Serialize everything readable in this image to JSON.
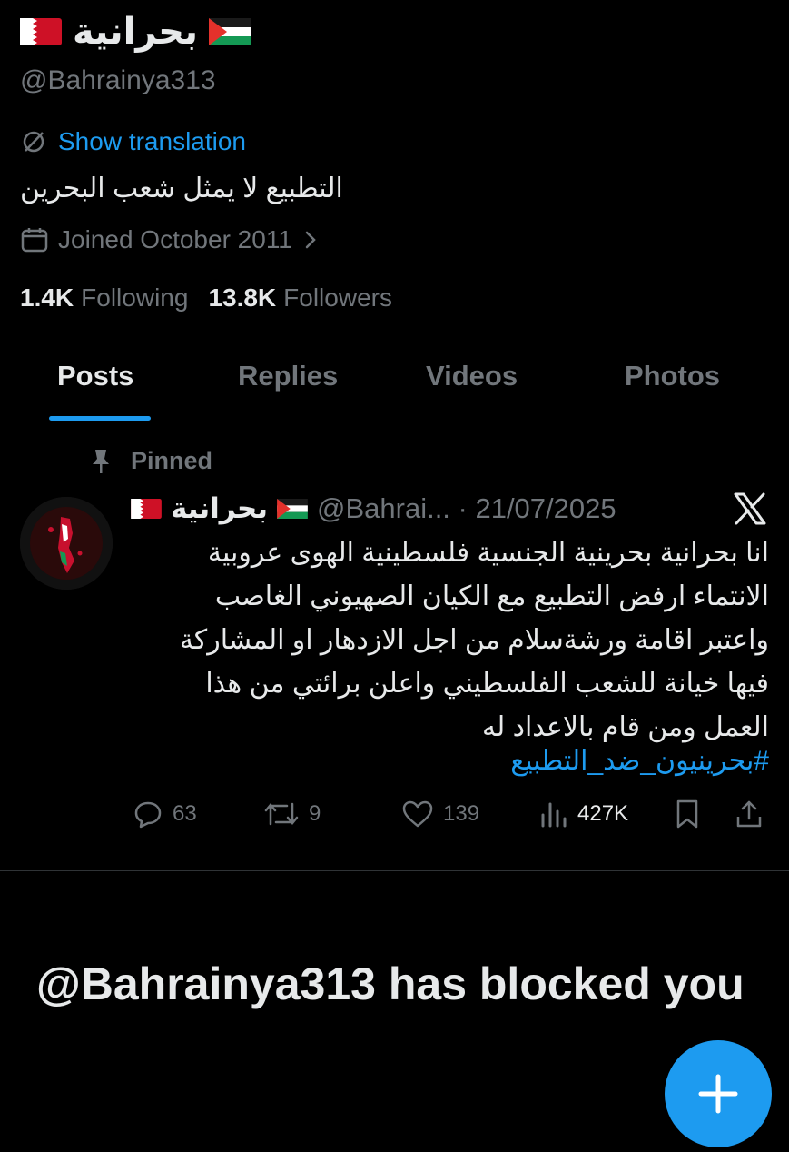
{
  "profile": {
    "display_name": "بحرانية",
    "handle": "@Bahrainya313",
    "translate_label": "Show translation",
    "bio": "التطبيع لا يمثل شعب البحرين",
    "joined": "Joined October 2011",
    "following_count": "1.4K",
    "following_label": "Following",
    "followers_count": "13.8K",
    "followers_label": "Followers"
  },
  "tabs": [
    {
      "label": "Posts"
    },
    {
      "label": "Replies"
    },
    {
      "label": "Videos"
    },
    {
      "label": "Photos"
    }
  ],
  "post": {
    "pinned_label": "Pinned",
    "author_name": "بحرانية",
    "author_handle_date": "@Bahrai... · 21/07/2025",
    "body": "انا بحرانية بحرينية الجنسية فلسطينية الهوى عروبية\nالانتماء ارفض التطبيع مع الكيان الصهيوني الغاصب\nواعتبر اقامة ورشةسلام من اجل الازدهار او المشاركة\nفيها خيانة للشعب الفلسطيني واعلن برائتي من هذا\nالعمل  ومن قام بالاعداد له",
    "hashtag": "#بحرينيون_ضد_التطبيع",
    "replies": "63",
    "reposts": "9",
    "likes": "139",
    "views": "427K"
  },
  "blocked_message": "@Bahrainya313 has blocked you",
  "colors": {
    "background": "#000000",
    "text": "#e7e9ea",
    "muted": "#71767b",
    "accent": "#1d9bf0",
    "divider": "#2f3336"
  },
  "icons": [
    "bahrain-flag-icon",
    "palestine-flag-icon",
    "translate-icon",
    "calendar-icon",
    "chevron-right-icon",
    "pin-icon",
    "x-logo-icon",
    "reply-icon",
    "repost-icon",
    "like-icon",
    "views-icon",
    "bookmark-icon",
    "share-icon",
    "compose-icon"
  ]
}
